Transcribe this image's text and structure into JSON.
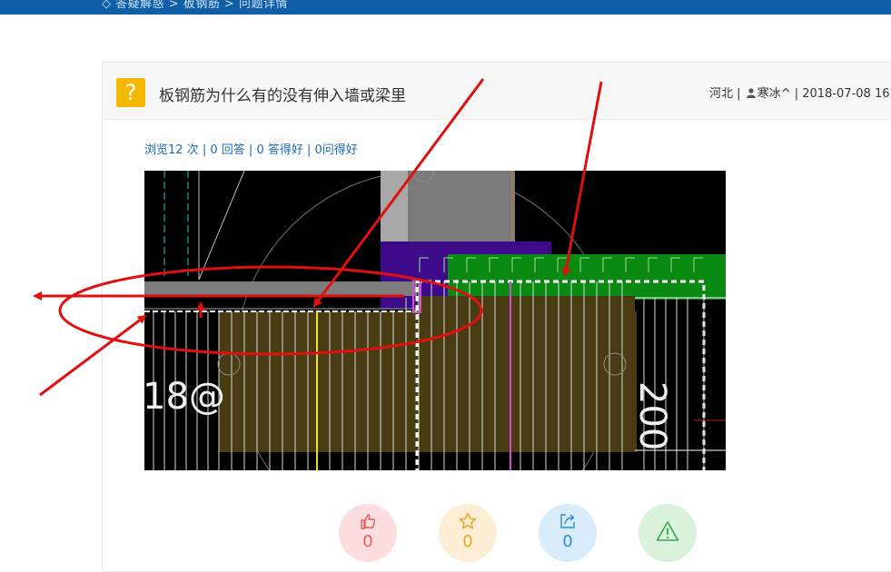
{
  "topbar": {
    "breadcrumb": "◇ 答疑解惑 > 板钢筋 > 问题详情"
  },
  "question": {
    "icon": "?",
    "title": "板钢筋为什么有的没有伸入墙或梁里",
    "location": "河北",
    "separator": "|",
    "author": "寒冰^",
    "date": "2018-07-08 16:"
  },
  "stats": {
    "views": "浏览12 次",
    "answers": "0 回答",
    "good_answers": "0 答得好",
    "good_questions": "0问得好",
    "sep": "|"
  },
  "drawing": {
    "label_left": "18@",
    "label_right": "200"
  },
  "actions": {
    "like": {
      "icon": "thumbs-up-icon",
      "count": "0",
      "color": "#e85a5a",
      "bg": "#fcdde0"
    },
    "favorite": {
      "icon": "star-icon",
      "count": "0",
      "color": "#f0a020",
      "bg": "#fcefd6"
    },
    "share": {
      "icon": "share-icon",
      "count": "0",
      "color": "#2b8fd8",
      "bg": "#d8ecfa"
    },
    "report": {
      "icon": "warning-icon",
      "color": "#34a853",
      "bg": "#daf2dc"
    }
  }
}
